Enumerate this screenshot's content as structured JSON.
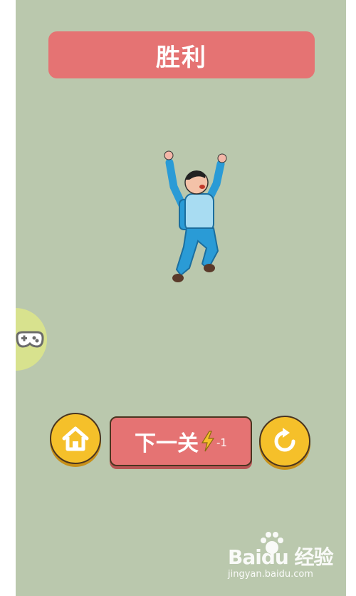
{
  "title": "胜利",
  "buttons": {
    "home_icon": "home-icon",
    "next_label": "下一关",
    "next_cost": "-1",
    "energy_icon": "lightning-icon",
    "retry_icon": "refresh-icon"
  },
  "side_tab": {
    "icon": "gamepad-icon"
  },
  "watermark": {
    "logo_text": "Baidu 经验",
    "url": "jingyan.baidu.com"
  },
  "colors": {
    "background": "#bac8ad",
    "banner": "#e57373",
    "button_yellow": "#f5c02a",
    "button_red": "#e57373",
    "side_tab": "#d8e28e"
  }
}
